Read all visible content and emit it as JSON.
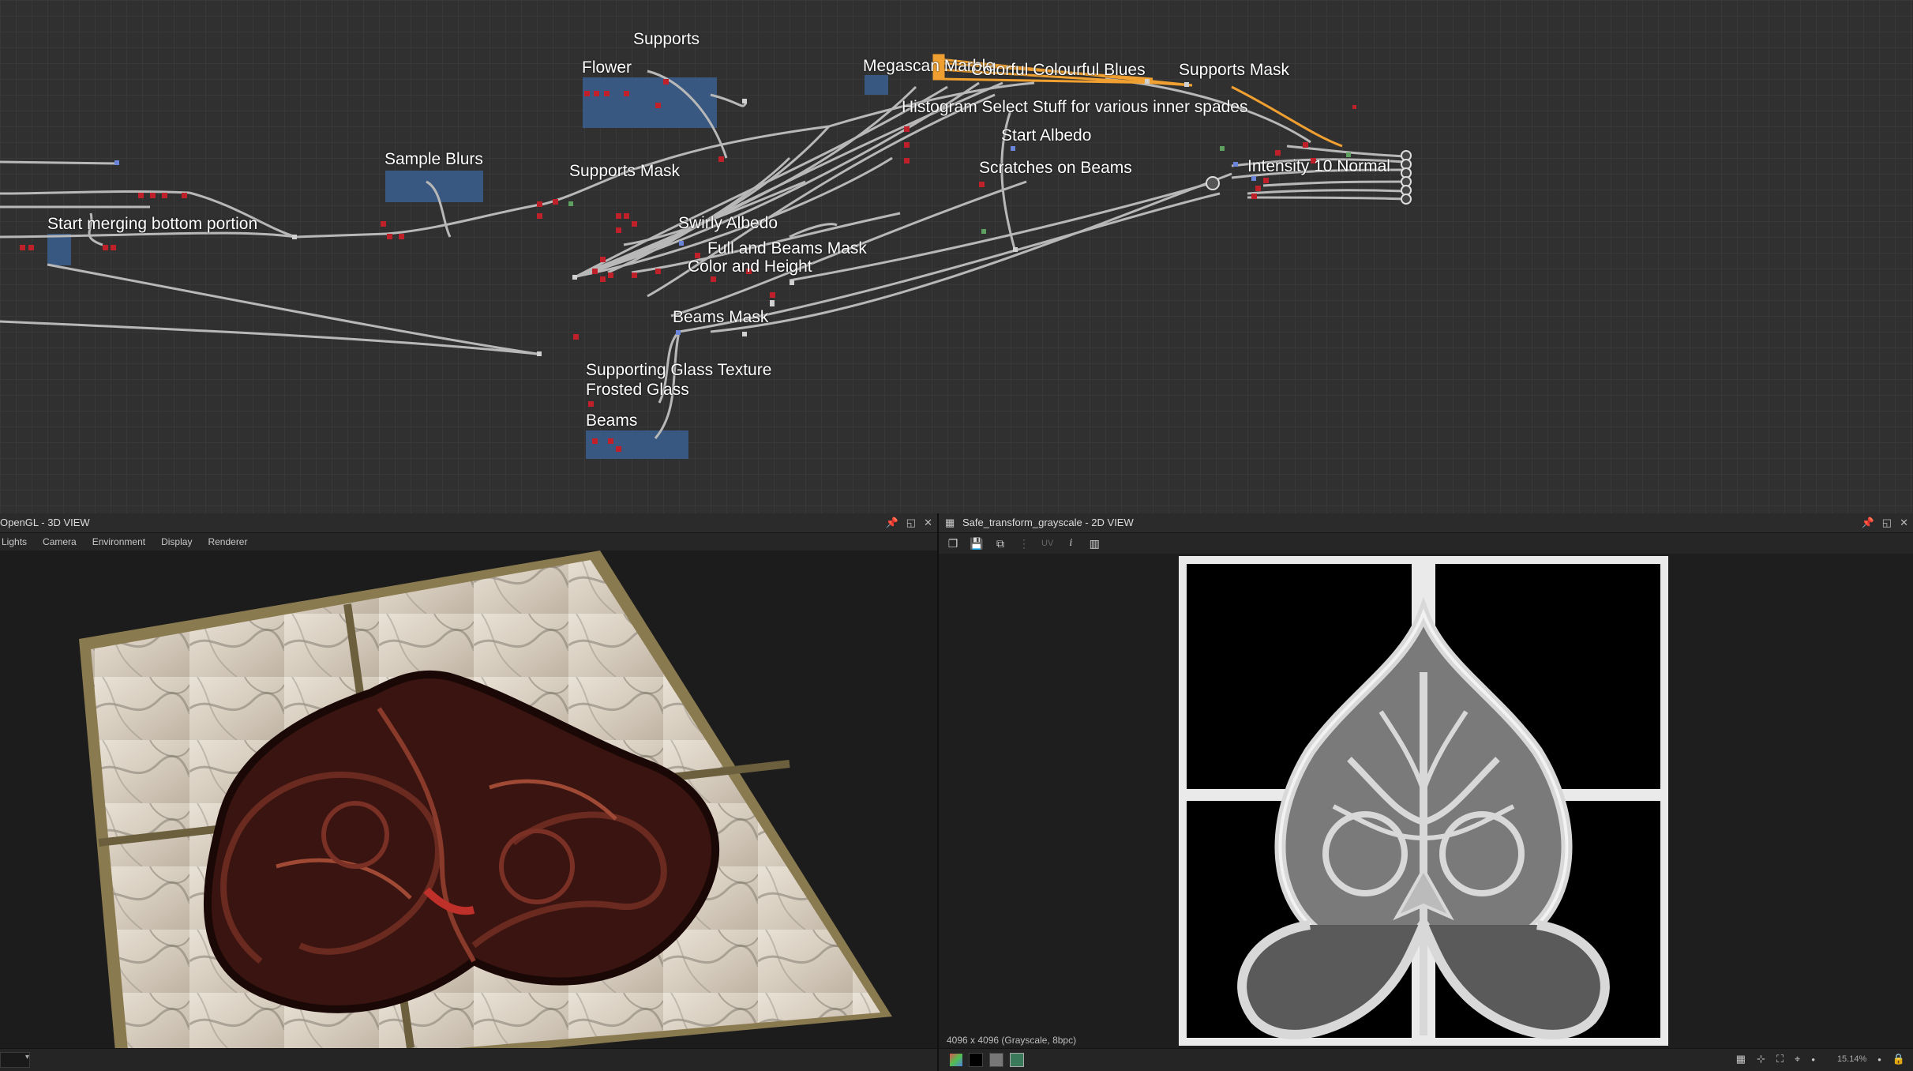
{
  "graph": {
    "frames": [
      {
        "id": "supports",
        "label": "Supports"
      },
      {
        "id": "flower",
        "label": "Flower"
      },
      {
        "id": "megascan",
        "label": "Megascan Marble"
      },
      {
        "id": "colorful",
        "label": "Colorful Colourful Blues"
      },
      {
        "id": "supports-mask-top",
        "label": "Supports Mask"
      },
      {
        "id": "histogram",
        "label": "Histogram Select Stuff for various inner spades"
      },
      {
        "id": "start-albedo",
        "label": "Start Albedo"
      },
      {
        "id": "scratches",
        "label": "Scratches on Beams"
      },
      {
        "id": "intensity",
        "label": "Intensity 10 Normal"
      },
      {
        "id": "sample-blurs",
        "label": "Sample Blurs"
      },
      {
        "id": "supports-mask",
        "label": "Supports Mask"
      },
      {
        "id": "start-merging",
        "label": "Start merging bottom portion"
      },
      {
        "id": "swirly",
        "label": "Swirly Albedo"
      },
      {
        "id": "full-beams",
        "label": "Full and Beams Mask"
      },
      {
        "id": "color-height",
        "label": "Color and Height"
      },
      {
        "id": "beams-mask",
        "label": "Beams Mask"
      },
      {
        "id": "supporting-glass",
        "label": "Supporting Glass Texture"
      },
      {
        "id": "frosted",
        "label": "Frosted Glass"
      },
      {
        "id": "beams",
        "label": "Beams"
      }
    ]
  },
  "view3d": {
    "title": "OpenGL - 3D VIEW",
    "menu": [
      "Lights",
      "Camera",
      "Environment",
      "Display",
      "Renderer"
    ]
  },
  "view2d": {
    "title": "Safe_transform_grayscale - 2D VIEW",
    "uv_label": "UV",
    "info_icon": "i",
    "image_info": "4096 x 4096 (Grayscale, 8bpc)",
    "zoom": "15.14%"
  },
  "colors": {
    "graph_bg": "#303030",
    "frame_blue": "#3a5f8f",
    "selected_orange": "#f0a030",
    "node_red": "#c0202a",
    "link_grey": "#b8b8b8"
  }
}
